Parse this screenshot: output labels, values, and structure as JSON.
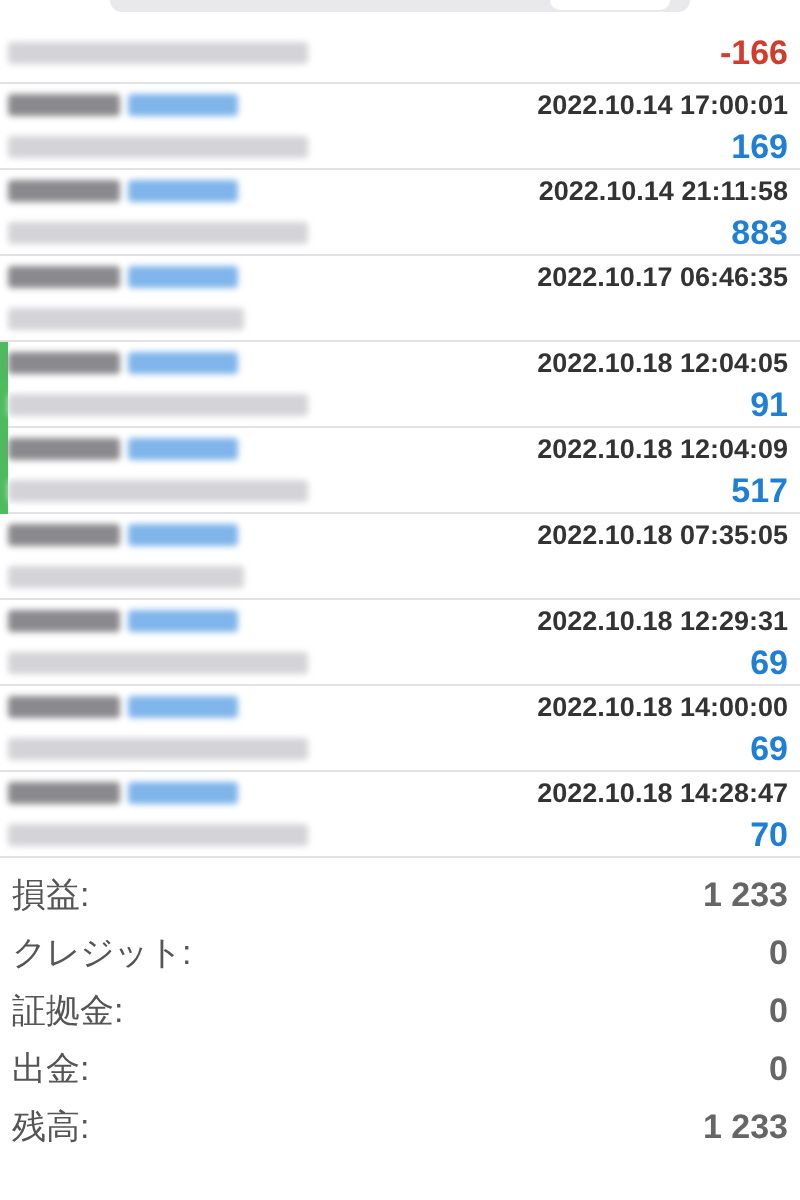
{
  "rows": [
    {
      "kind": "deal",
      "time": "",
      "profit": "-166",
      "color": "#d23c2c",
      "highlighted": false
    },
    {
      "kind": "deal",
      "time": "2022.10.14 17:00:01",
      "profit": "169",
      "color": "#1f7fd4",
      "highlighted": false
    },
    {
      "kind": "deal",
      "time": "2022.10.14 21:11:58",
      "profit": "883",
      "color": "#1f7fd4",
      "highlighted": false
    },
    {
      "kind": "order",
      "time": "2022.10.17 06:46:35",
      "highlighted": false
    },
    {
      "kind": "deal",
      "time": "2022.10.18 12:04:05",
      "profit": "91",
      "color": "#1f7fd4",
      "highlighted": true
    },
    {
      "kind": "deal",
      "time": "2022.10.18 12:04:09",
      "profit": "517",
      "color": "#1f7fd4",
      "highlighted": true
    },
    {
      "kind": "order",
      "time": "2022.10.18 07:35:05",
      "highlighted": false
    },
    {
      "kind": "deal",
      "time": "2022.10.18 12:29:31",
      "profit": "69",
      "color": "#1f7fd4",
      "highlighted": false
    },
    {
      "kind": "deal",
      "time": "2022.10.18 14:00:00",
      "profit": "69",
      "color": "#1f7fd4",
      "highlighted": false
    },
    {
      "kind": "deal",
      "time": "2022.10.18 14:28:47",
      "profit": "70",
      "color": "#1f7fd4",
      "highlighted": false
    }
  ],
  "summary": [
    {
      "label": "損益:",
      "value": "1 233"
    },
    {
      "label": "クレジット:",
      "value": "0"
    },
    {
      "label": "証拠金:",
      "value": "0"
    },
    {
      "label": "出金:",
      "value": "0"
    },
    {
      "label": "残高:",
      "value": "1 233"
    }
  ]
}
